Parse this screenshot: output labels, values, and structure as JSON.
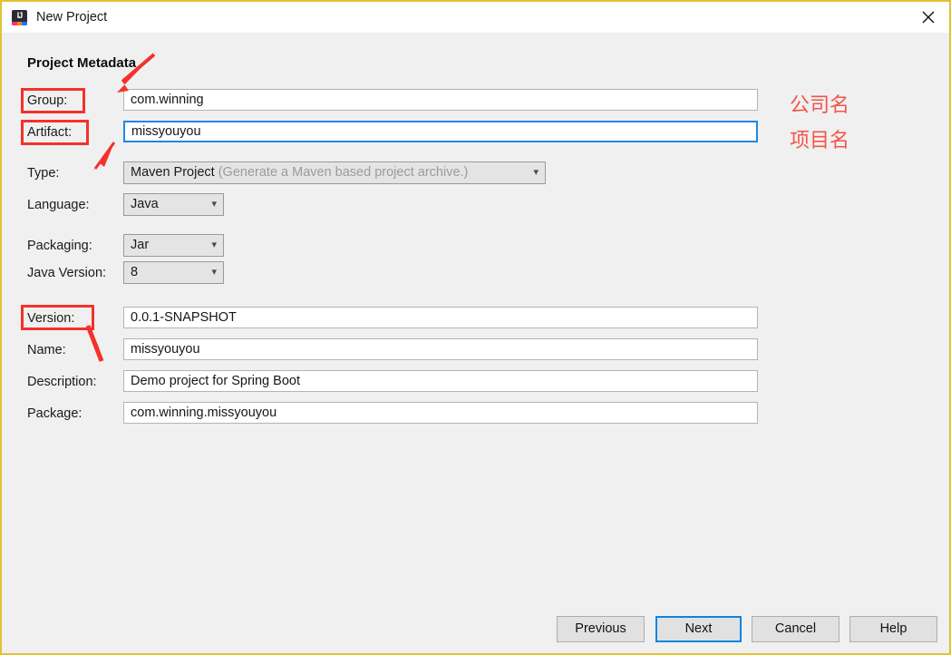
{
  "window": {
    "title": "New Project",
    "app_icon": "intellij-idea-icon",
    "close_icon": "close-icon",
    "border_color": "#e2c233",
    "background": "#f0f0f0"
  },
  "form": {
    "heading": "Project Metadata",
    "fields": [
      {
        "label": "Group:",
        "value": "com.winning",
        "kind": "text",
        "focused": false
      },
      {
        "label": "Artifact:",
        "value": "missyouyou",
        "kind": "text",
        "focused": true
      },
      {
        "label": "Type:",
        "value": "Maven Project",
        "hint": "(Generate a Maven based project archive.)",
        "kind": "combo-wide"
      },
      {
        "label": "Language:",
        "value": "Java",
        "kind": "combo-small"
      },
      {
        "label": "Packaging:",
        "value": "Jar",
        "kind": "combo-small"
      },
      {
        "label": "Java Version:",
        "value": "8",
        "kind": "combo-small"
      },
      {
        "label": "Version:",
        "value": "0.0.1-SNAPSHOT",
        "kind": "text",
        "focused": false
      },
      {
        "label": "Name:",
        "value": "missyouyou",
        "kind": "text",
        "focused": false
      },
      {
        "label": "Description:",
        "value": "Demo project for Spring Boot",
        "kind": "text",
        "focused": false
      },
      {
        "label": "Package:",
        "value": "com.winning.missyouyou",
        "kind": "text",
        "focused": false
      }
    ]
  },
  "buttons": [
    {
      "label": "Previous",
      "default": false
    },
    {
      "label": "Next",
      "default": true
    },
    {
      "label": "Cancel",
      "default": false
    },
    {
      "label": "Help",
      "default": false
    }
  ],
  "annotations": {
    "color": "#f4312a",
    "text_color": "#f4544b",
    "highlight_boxes": [
      "Group:",
      "Artifact:",
      "Version:"
    ],
    "notes": [
      {
        "text": "公司名",
        "refers_to": "Group:"
      },
      {
        "text": "项目名",
        "refers_to": "Artifact:"
      }
    ]
  }
}
